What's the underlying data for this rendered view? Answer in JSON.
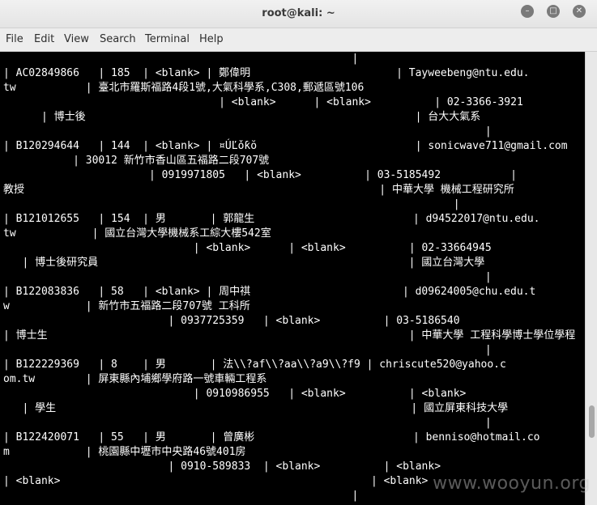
{
  "window": {
    "title": "root@kali: ~",
    "minimize_glyph": "–",
    "maximize_glyph": "□",
    "close_glyph": "✕"
  },
  "menu": {
    "file": "File",
    "edit": "Edit",
    "view": "View",
    "search": "Search",
    "terminal": "Terminal",
    "help": "Help"
  },
  "terminal": {
    "lines": [
      "                                                       |",
      "| AC02849866   | 185  | <blank> | 鄭偉明                       | Tayweebeng@ntu.edu.",
      "tw           | 臺北市羅斯福路4段1號,大氣科學系,C308,郵遞區號106",
      "                                  | <blank>      | <blank>          | 02-3366-3921",
      "      | 博士後                                                    | 台大大氣系",
      "                                                                            |",
      "| B120294644   | 144  | <blank> | ¤ÚĽǒƙŏ                         | sonicwave711@gmail.com",
      "           | 30012 新竹市香山區五福路二段707號",
      "                       | 0919971805   | <blank>          | 03-5185492           |",
      "教授                                                        | 中華大學 機械工程研究所",
      "                                                                       |",
      "| B121012655   | 154  | 男       | 郭龍生                         | d94522017@ntu.edu.",
      "tw            | 國立台灣大學機械系工綜大樓542室",
      "                              | <blank>      | <blank>          | 02-33664945",
      "   | 博士後研究員                                                 | 國立台灣大學",
      "                                                                            |",
      "| B122083836   | 58   | <blank> | 周中祺                        | d09624005@chu.edu.t",
      "w            | 新竹市五福路二段707號 工科所",
      "                          | 0937725359   | <blank>          | 03-5186540",
      "| 博士生                                                         | 中華大學 工程科學博士學位學程",
      "                                                                            |",
      "| B122229369   | 8    | 男       | 法\\\\?af\\\\?aa\\\\?a9\\\\?f9 | chriscute520@yahoo.c",
      "om.tw        | 屏東縣內埔鄉學府路一號車輛工程系",
      "                              | 0910986955   | <blank>          | <blank>",
      "   | 學生                                                        | 國立屏東科技大學",
      "                                                                            |",
      "| B122420071   | 55   | 男       | 曾廣彬                         | benniso@hotmail.co",
      "m            | 桃園縣中壢市中央路46號401房",
      "                          | 0910-589833  | <blank>          | <blank>",
      "| <blank>                                                 | <blank>",
      "                                                       |"
    ]
  },
  "watermark": "www.wooyun.org"
}
